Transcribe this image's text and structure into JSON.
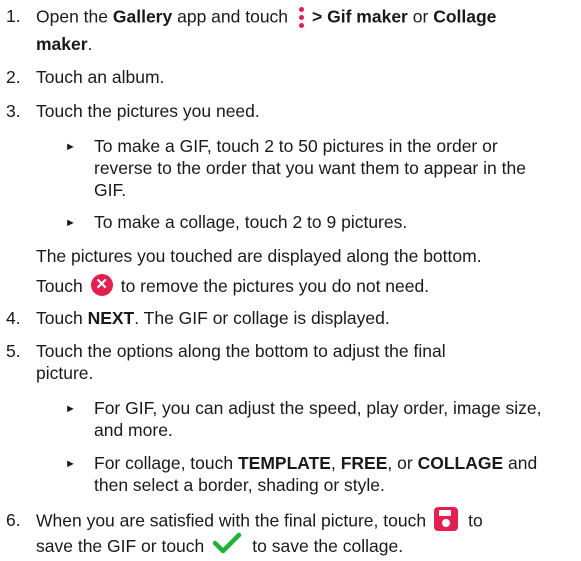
{
  "steps": [
    {
      "num": "1.",
      "lines": [
        "Open the",
        "Gallery",
        "app and touch",
        "> Gif maker",
        "or",
        "Collage",
        "maker",
        "."
      ]
    },
    {
      "num": "2.",
      "text": "Touch an album."
    },
    {
      "num": "3.",
      "text": "Touch the pictures you need."
    },
    {
      "num": "4.",
      "pre": "Touch ",
      "bold": "NEXT",
      "post": ". The GIF or collage is displayed."
    },
    {
      "num": "5.",
      "lines": [
        "Touch the options along the bottom to adjust the final",
        "picture."
      ]
    },
    {
      "num": "6.",
      "pre": "When you are satisfied with the final picture, touch",
      "post": "to",
      "line2a": "save the GIF or touch",
      "line2b": "to save the collage."
    }
  ],
  "step3_bullets": [
    {
      "lines": [
        "To make a GIF, touch 2 to 50 pictures in the order or",
        "reverse to the order that you want them to appear in the",
        "GIF."
      ]
    },
    {
      "lines": [
        "To make a collage, touch 2 to 9 pictures."
      ]
    }
  ],
  "step3_after": [
    "The pictures you touched are displayed along the bottom.",
    "Touch",
    "to remove the pictures you do not need."
  ],
  "step5_bullets": [
    {
      "lines": [
        "For GIF, you can adjust the speed, play order, image size,",
        "and more."
      ]
    },
    {
      "parts": [
        "For collage, touch ",
        "TEMPLATE",
        ", ",
        "FREE",
        ", or ",
        "COLLAGE",
        " and"
      ],
      "line2": "then select a border, shading or style."
    }
  ],
  "bullet_glyph": "►",
  "icons": {
    "menu": "more-vertical-icon",
    "remove": "remove-circle-icon",
    "save": "save-icon",
    "check": "checkmark-icon",
    "remove_glyph": "✕"
  },
  "colors": {
    "accent": "#e3204f",
    "check": "#1db33a",
    "text": "#1a1a1a"
  }
}
